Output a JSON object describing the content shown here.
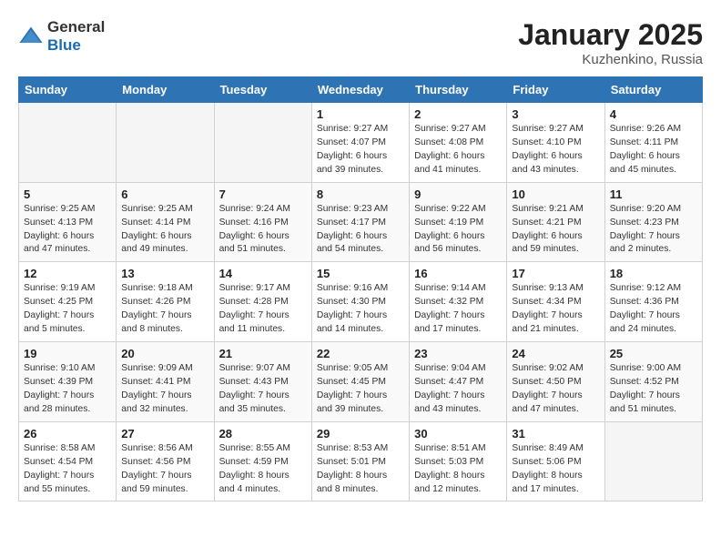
{
  "logo": {
    "general": "General",
    "blue": "Blue"
  },
  "title": "January 2025",
  "location": "Kuzhenkino, Russia",
  "weekdays": [
    "Sunday",
    "Monday",
    "Tuesday",
    "Wednesday",
    "Thursday",
    "Friday",
    "Saturday"
  ],
  "weeks": [
    [
      {
        "day": "",
        "sunrise": "",
        "sunset": "",
        "daylight": "",
        "empty": true
      },
      {
        "day": "",
        "sunrise": "",
        "sunset": "",
        "daylight": "",
        "empty": true
      },
      {
        "day": "",
        "sunrise": "",
        "sunset": "",
        "daylight": "",
        "empty": true
      },
      {
        "day": "1",
        "sunrise": "Sunrise: 9:27 AM",
        "sunset": "Sunset: 4:07 PM",
        "daylight": "Daylight: 6 hours and 39 minutes."
      },
      {
        "day": "2",
        "sunrise": "Sunrise: 9:27 AM",
        "sunset": "Sunset: 4:08 PM",
        "daylight": "Daylight: 6 hours and 41 minutes."
      },
      {
        "day": "3",
        "sunrise": "Sunrise: 9:27 AM",
        "sunset": "Sunset: 4:10 PM",
        "daylight": "Daylight: 6 hours and 43 minutes."
      },
      {
        "day": "4",
        "sunrise": "Sunrise: 9:26 AM",
        "sunset": "Sunset: 4:11 PM",
        "daylight": "Daylight: 6 hours and 45 minutes."
      }
    ],
    [
      {
        "day": "5",
        "sunrise": "Sunrise: 9:25 AM",
        "sunset": "Sunset: 4:13 PM",
        "daylight": "Daylight: 6 hours and 47 minutes."
      },
      {
        "day": "6",
        "sunrise": "Sunrise: 9:25 AM",
        "sunset": "Sunset: 4:14 PM",
        "daylight": "Daylight: 6 hours and 49 minutes."
      },
      {
        "day": "7",
        "sunrise": "Sunrise: 9:24 AM",
        "sunset": "Sunset: 4:16 PM",
        "daylight": "Daylight: 6 hours and 51 minutes."
      },
      {
        "day": "8",
        "sunrise": "Sunrise: 9:23 AM",
        "sunset": "Sunset: 4:17 PM",
        "daylight": "Daylight: 6 hours and 54 minutes."
      },
      {
        "day": "9",
        "sunrise": "Sunrise: 9:22 AM",
        "sunset": "Sunset: 4:19 PM",
        "daylight": "Daylight: 6 hours and 56 minutes."
      },
      {
        "day": "10",
        "sunrise": "Sunrise: 9:21 AM",
        "sunset": "Sunset: 4:21 PM",
        "daylight": "Daylight: 6 hours and 59 minutes."
      },
      {
        "day": "11",
        "sunrise": "Sunrise: 9:20 AM",
        "sunset": "Sunset: 4:23 PM",
        "daylight": "Daylight: 7 hours and 2 minutes."
      }
    ],
    [
      {
        "day": "12",
        "sunrise": "Sunrise: 9:19 AM",
        "sunset": "Sunset: 4:25 PM",
        "daylight": "Daylight: 7 hours and 5 minutes."
      },
      {
        "day": "13",
        "sunrise": "Sunrise: 9:18 AM",
        "sunset": "Sunset: 4:26 PM",
        "daylight": "Daylight: 7 hours and 8 minutes."
      },
      {
        "day": "14",
        "sunrise": "Sunrise: 9:17 AM",
        "sunset": "Sunset: 4:28 PM",
        "daylight": "Daylight: 7 hours and 11 minutes."
      },
      {
        "day": "15",
        "sunrise": "Sunrise: 9:16 AM",
        "sunset": "Sunset: 4:30 PM",
        "daylight": "Daylight: 7 hours and 14 minutes."
      },
      {
        "day": "16",
        "sunrise": "Sunrise: 9:14 AM",
        "sunset": "Sunset: 4:32 PM",
        "daylight": "Daylight: 7 hours and 17 minutes."
      },
      {
        "day": "17",
        "sunrise": "Sunrise: 9:13 AM",
        "sunset": "Sunset: 4:34 PM",
        "daylight": "Daylight: 7 hours and 21 minutes."
      },
      {
        "day": "18",
        "sunrise": "Sunrise: 9:12 AM",
        "sunset": "Sunset: 4:36 PM",
        "daylight": "Daylight: 7 hours and 24 minutes."
      }
    ],
    [
      {
        "day": "19",
        "sunrise": "Sunrise: 9:10 AM",
        "sunset": "Sunset: 4:39 PM",
        "daylight": "Daylight: 7 hours and 28 minutes."
      },
      {
        "day": "20",
        "sunrise": "Sunrise: 9:09 AM",
        "sunset": "Sunset: 4:41 PM",
        "daylight": "Daylight: 7 hours and 32 minutes."
      },
      {
        "day": "21",
        "sunrise": "Sunrise: 9:07 AM",
        "sunset": "Sunset: 4:43 PM",
        "daylight": "Daylight: 7 hours and 35 minutes."
      },
      {
        "day": "22",
        "sunrise": "Sunrise: 9:05 AM",
        "sunset": "Sunset: 4:45 PM",
        "daylight": "Daylight: 7 hours and 39 minutes."
      },
      {
        "day": "23",
        "sunrise": "Sunrise: 9:04 AM",
        "sunset": "Sunset: 4:47 PM",
        "daylight": "Daylight: 7 hours and 43 minutes."
      },
      {
        "day": "24",
        "sunrise": "Sunrise: 9:02 AM",
        "sunset": "Sunset: 4:50 PM",
        "daylight": "Daylight: 7 hours and 47 minutes."
      },
      {
        "day": "25",
        "sunrise": "Sunrise: 9:00 AM",
        "sunset": "Sunset: 4:52 PM",
        "daylight": "Daylight: 7 hours and 51 minutes."
      }
    ],
    [
      {
        "day": "26",
        "sunrise": "Sunrise: 8:58 AM",
        "sunset": "Sunset: 4:54 PM",
        "daylight": "Daylight: 7 hours and 55 minutes."
      },
      {
        "day": "27",
        "sunrise": "Sunrise: 8:56 AM",
        "sunset": "Sunset: 4:56 PM",
        "daylight": "Daylight: 7 hours and 59 minutes."
      },
      {
        "day": "28",
        "sunrise": "Sunrise: 8:55 AM",
        "sunset": "Sunset: 4:59 PM",
        "daylight": "Daylight: 8 hours and 4 minutes."
      },
      {
        "day": "29",
        "sunrise": "Sunrise: 8:53 AM",
        "sunset": "Sunset: 5:01 PM",
        "daylight": "Daylight: 8 hours and 8 minutes."
      },
      {
        "day": "30",
        "sunrise": "Sunrise: 8:51 AM",
        "sunset": "Sunset: 5:03 PM",
        "daylight": "Daylight: 8 hours and 12 minutes."
      },
      {
        "day": "31",
        "sunrise": "Sunrise: 8:49 AM",
        "sunset": "Sunset: 5:06 PM",
        "daylight": "Daylight: 8 hours and 17 minutes."
      },
      {
        "day": "",
        "sunrise": "",
        "sunset": "",
        "daylight": "",
        "empty": true
      }
    ]
  ]
}
